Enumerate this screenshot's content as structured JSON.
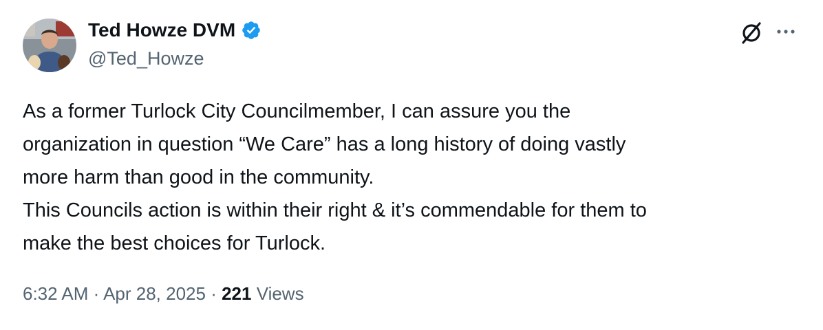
{
  "author": {
    "name": "Ted Howze DVM",
    "handle": "@Ted_Howze",
    "verified_color": "#1d9bf0"
  },
  "tweet": {
    "lines": [
      "As a former Turlock City Councilmember, I can assure you the",
      "organization in question “We Care” has a long history of doing vastly",
      "more harm than good in the community.",
      "This Councils action is within their right & it’s commendable for them to",
      "make the best choices for Turlock."
    ]
  },
  "meta": {
    "time": "6:32 AM",
    "separator": " · ",
    "date": "Apr 28, 2025",
    "views_count": "221",
    "views_label": "Views"
  },
  "icons": {
    "verified": "verified-badge-icon",
    "grok": "grok-icon",
    "more": "more-options-icon"
  }
}
